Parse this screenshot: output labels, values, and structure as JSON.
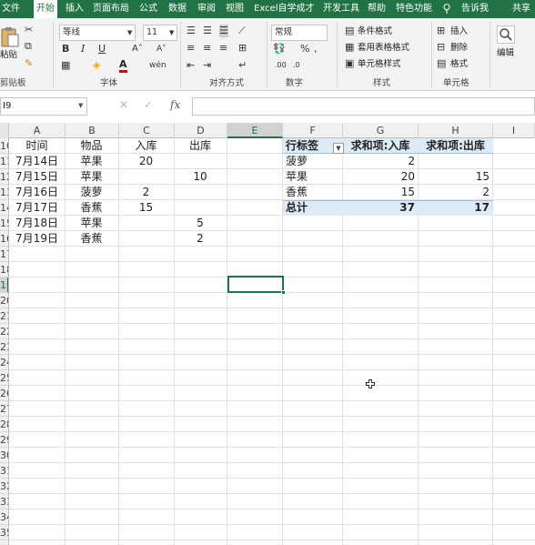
{
  "ribbon": {
    "tabs": [
      "文件",
      "开始",
      "插入",
      "页面布局",
      "公式",
      "数据",
      "审阅",
      "视图",
      "Excel自学成才",
      "开发工具",
      "帮助",
      "特色功能"
    ],
    "tell_me": "告诉我",
    "share": "共享",
    "clipboard": {
      "paste": "粘贴",
      "label": "剪贴板"
    },
    "font": {
      "name": "等线",
      "size": "11",
      "label": "字体",
      "bold": "B",
      "italic": "I",
      "underline": "U"
    },
    "alignment": {
      "label": "对齐方式"
    },
    "number": {
      "format": "常规",
      "label": "数字"
    },
    "styles": {
      "conditional": "条件格式",
      "table": "套用表格格式",
      "cell": "单元格样式",
      "label": "样式"
    },
    "cells": {
      "insert": "插入",
      "delete": "删除",
      "format": "格式",
      "label": "单元格"
    },
    "editing": {
      "label": "编辑"
    }
  },
  "formula_bar": {
    "name_box": "I9",
    "fx": "fx",
    "value": ""
  },
  "grid": {
    "columns": [
      "A",
      "B",
      "C",
      "D",
      "E",
      "F",
      "G",
      "H",
      "I"
    ],
    "selected_column": "E",
    "row_numbers": [
      "10",
      "11",
      "12",
      "13",
      "14",
      "15",
      "16",
      "17",
      "18",
      "19",
      "20",
      "21",
      "22",
      "23",
      "24",
      "25",
      "26",
      "27",
      "28",
      "29",
      "30",
      "31",
      "32",
      "33",
      "34",
      "35"
    ],
    "selected_row": "19",
    "source_table": {
      "headers": [
        "时间",
        "物品",
        "入库",
        "出库"
      ],
      "rows": [
        [
          "7月14日",
          "苹果",
          "20",
          ""
        ],
        [
          "7月15日",
          "苹果",
          "",
          "10"
        ],
        [
          "7月16日",
          "菠萝",
          "2",
          ""
        ],
        [
          "7月17日",
          "香蕉",
          "15",
          ""
        ],
        [
          "7月18日",
          "苹果",
          "",
          "5"
        ],
        [
          "7月19日",
          "香蕉",
          "",
          "2"
        ]
      ]
    },
    "pivot_table": {
      "headers": [
        "行标签",
        "求和项:入库",
        "求和项:出库"
      ],
      "rows": [
        [
          "菠萝",
          "2",
          ""
        ],
        [
          "苹果",
          "20",
          "15"
        ],
        [
          "香蕉",
          "15",
          "2"
        ]
      ],
      "total": [
        "总计",
        "37",
        "17"
      ]
    }
  },
  "colors": {
    "brand": "#217346",
    "pivot_header": "#ddebf7",
    "pivot_border": "#9bc2e6"
  }
}
